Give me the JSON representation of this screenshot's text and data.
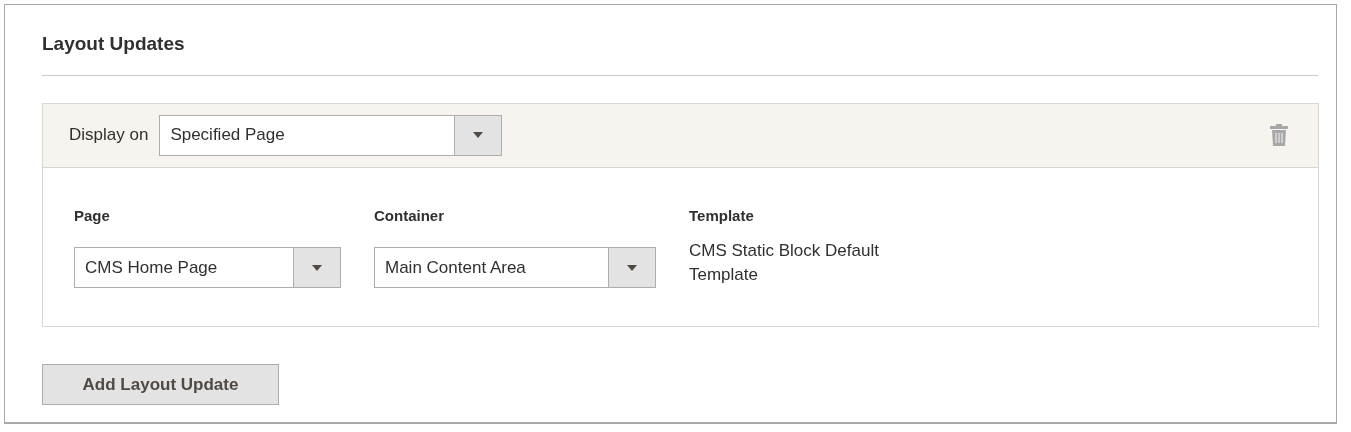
{
  "section": {
    "title": "Layout Updates"
  },
  "layout_update": {
    "display_on": {
      "label": "Display on",
      "value": "Specified Page"
    },
    "fields": [
      {
        "label": "Page",
        "kind": "select",
        "value": "CMS Home Page"
      },
      {
        "label": "Container",
        "kind": "select",
        "value": "Main Content Area"
      },
      {
        "label": "Template",
        "kind": "text",
        "value": "CMS Static Block Default Template"
      }
    ]
  },
  "add_button": "Add Layout Update"
}
